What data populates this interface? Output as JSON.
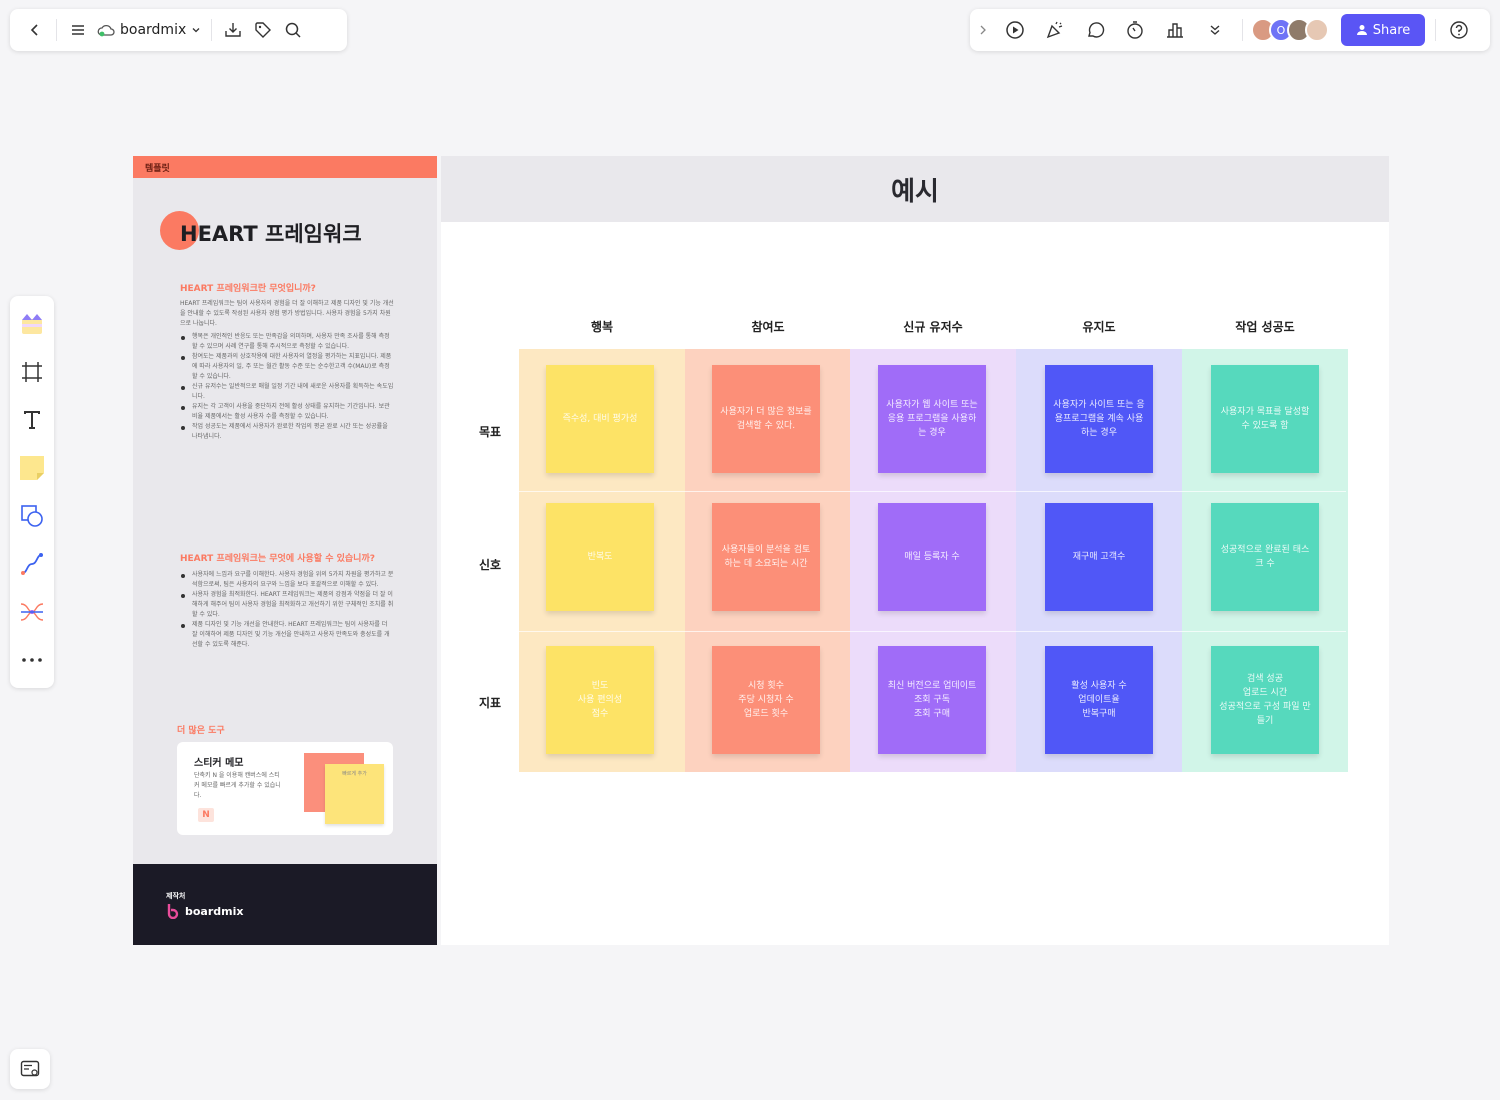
{
  "header": {
    "brand": "boardmix",
    "share_label": "Share",
    "avatar_letter": "O"
  },
  "template": {
    "tag": "템플릿",
    "title": "HEART 프레임워크",
    "section1_title": "HEART 프레임워크란 무엇입니까?",
    "section1_intro": "HEART 프레임워크는 팀이 사용자의 경험을 더 잘 이해하고 제품 디자인 및 기능 개선을 안내할 수 있도록 작성된 사용자 경험 평가 방법입니다. 사용자 경험을 5가지 차원으로 나눕니다.",
    "section1_bullets": [
      "행복은 개인적인 반응도 또는 만족감을 의미하며, 사용자 만족 조사를 통해 측정할 수 있으며 사례 연구를 통해 주시적으로 측정할 수 있습니다.",
      "참여도는 제품과의 상호작용에 대한 사용자의 열정을 평가하는 지표입니다. 제품에 따라 사용자의 일, 주 또는 월간 활동 수준 또는 순수한고객 수(MAU)로 측정할 수 있습니다.",
      "신규 유저수는 일반적으로 매월 일정 기간 내에 새로운 사용자를 획득하는 속도입니다.",
      "유지는 각 고객이 사용을 중단하지 전에 활성 상태를 유지하는 기간입니다. 보관 비율 제품에서는 활성 사용자 수를 측정할 수 있습니다.",
      "작업 성공도는 제품에서 사용자가 완료한 작업의 평균 완료 시간 또는 성공률을 나타냅니다."
    ],
    "section2_title": "HEART 프레임워크는 무엇에 사용할 수 있습니까?",
    "section2_bullets": [
      "사용자에 느낌과 요구를 이해한다. 사용자 경험을 위의 5가지 차원을 평가하고 분석함으로써, 팀은 사용자의 요구와 느낌을 보다 포괄적으로 이해할 수 있다.",
      "사용자 경험을 최적화한다. HEART 프레임워크는 제품의 강점과 약점을 더 잘 이해하게 해주어 팀이 사용자 경험을 최적화하고 개선하기 위한 구체적인 조치를 취할 수 있다.",
      "제품 디자인 및 기능 개선을 안내한다. HEART 프레임워크는 팀이 사용자를 더 잘 이해하여 제품 디자인 및 기능 개선을 안내하고 사용자 만족도와 충성도를 개선할 수 있도록 해준다."
    ],
    "more_tools": "더 많은 도구",
    "tool_title": "스티커 메모",
    "tool_desc": "단축키 N 을 이용해 캔버스에 스티커 메모를 빠르게 추가할 수 있습니다.",
    "tool_key": "N",
    "mini_sticky_text": "빠르게 추가",
    "footer_caption": "제작처",
    "footer_brand": "boardmix"
  },
  "example": {
    "title": "예시",
    "columns": [
      "행복",
      "참여도",
      "신규 유저수",
      "유지도",
      "작업 성공도"
    ],
    "rows": [
      "목표",
      "신호",
      "지표"
    ],
    "column_bg": [
      "#fde8c2",
      "#fdd2bf",
      "#ecdcfa",
      "#dcdcfb",
      "#d1f5e8"
    ],
    "sticky_colors": [
      "#fde366",
      "#fc8f78",
      "#a06cf8",
      "#5057f7",
      "#56d9bd"
    ],
    "stickies": [
      [
        "즉수성, 대비 평가성",
        "사용자가 더 많은 정보를 검색할 수 있다.",
        "사용자가 웹 사이트 또는 응용 프로그램을 사용하는 경우",
        "사용자가 사이트 또는 응용프로그램을 계속 사용하는 경우",
        "사용자가 목표를 달성할 수 있도록 함"
      ],
      [
        "반복도",
        "사용자들이 분석을 검토하는 데 소요되는 시간",
        "매일 등록자 수",
        "재구매 고객수",
        "성공적으로 완료된 태스크 수"
      ],
      [
        "빈도\n사용 편의성\n점수",
        "시청 횟수\n주당 시청자 수\n업로드 횟수",
        "최신 버전으로 업데이트\n조회 구독\n조회 구매",
        "활성 사용자 수\n업데이트율\n반복구매",
        "검색 성공\n업로드 시간\n성공적으로 구성 파일 만들기"
      ]
    ]
  }
}
